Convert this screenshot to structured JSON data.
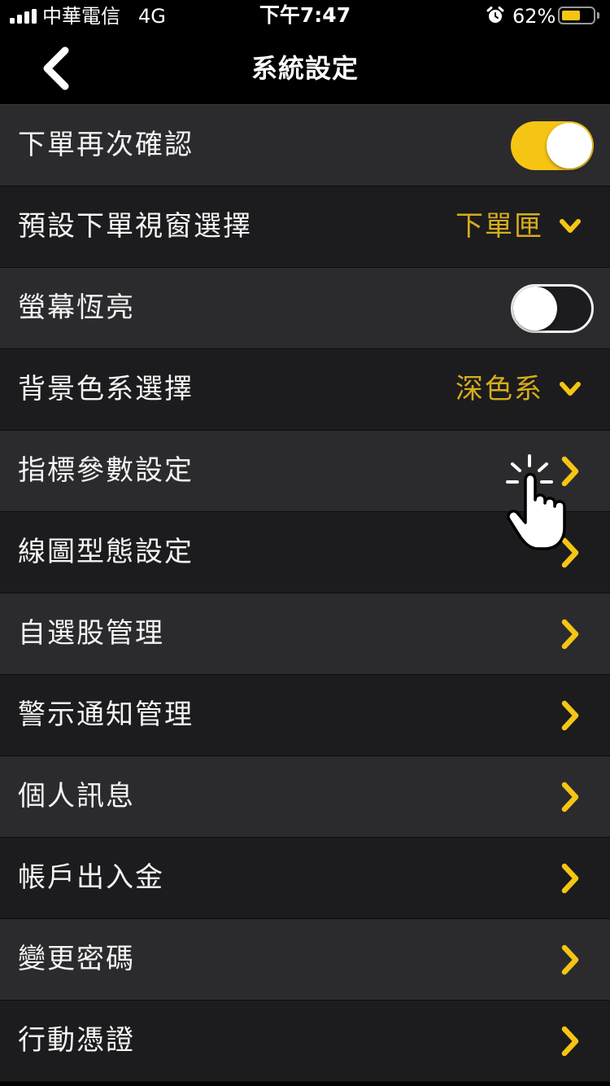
{
  "status_bar": {
    "carrier": "中華電信",
    "network": "4G",
    "time": "下午7:47",
    "battery_percent": "62%",
    "battery_level": 0.62,
    "alarm_icon": "alarm-clock-icon",
    "signal_icon": "signal-bars-icon"
  },
  "nav": {
    "title": "系統設定",
    "back_icon": "chevron-left-icon"
  },
  "colors": {
    "accent": "#f6c514",
    "value_text": "#d6ad1c",
    "row_light": "#2b2b2e",
    "row_dark": "#1c1c1e"
  },
  "settings": [
    {
      "label": "下單再次確認",
      "control": "toggle",
      "on": true
    },
    {
      "label": "預設下單視窗選擇",
      "control": "select",
      "value": "下單匣"
    },
    {
      "label": "螢幕恆亮",
      "control": "toggle",
      "on": false
    },
    {
      "label": "背景色系選擇",
      "control": "select",
      "value": "深色系"
    },
    {
      "label": "指標參數設定",
      "control": "link"
    },
    {
      "label": "線圖型態設定",
      "control": "link"
    },
    {
      "label": "自選股管理",
      "control": "link"
    },
    {
      "label": "警示通知管理",
      "control": "link"
    },
    {
      "label": "個人訊息",
      "control": "link"
    },
    {
      "label": "帳戶出入金",
      "control": "link"
    },
    {
      "label": "變更密碼",
      "control": "link"
    },
    {
      "label": "行動憑證",
      "control": "link"
    }
  ],
  "tap_indicator_icon": "tap-hand-icon"
}
